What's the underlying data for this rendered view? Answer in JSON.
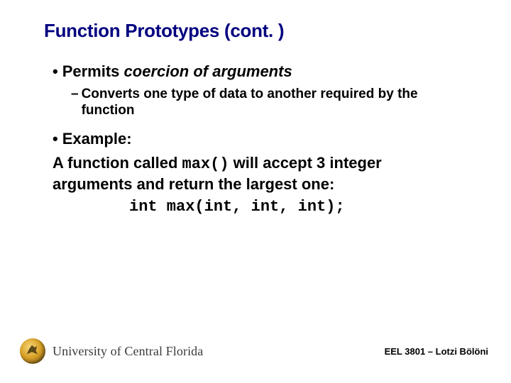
{
  "title": "Function Prototypes (cont. )",
  "bullets": [
    {
      "label_prefix": "Permits ",
      "label_italic": "coercion of arguments",
      "sub": "Converts one type of data to another required by the function"
    }
  ],
  "example": {
    "heading": "Example:",
    "line_pre": "A function called ",
    "line_code": "max()",
    "line_post": " will accept 3 integer arguments and return the largest one:",
    "code": "int max(int, int, int);"
  },
  "footer": {
    "university": "University of Central Florida",
    "course": "EEL 3801 – Lotzi Bölöni"
  }
}
